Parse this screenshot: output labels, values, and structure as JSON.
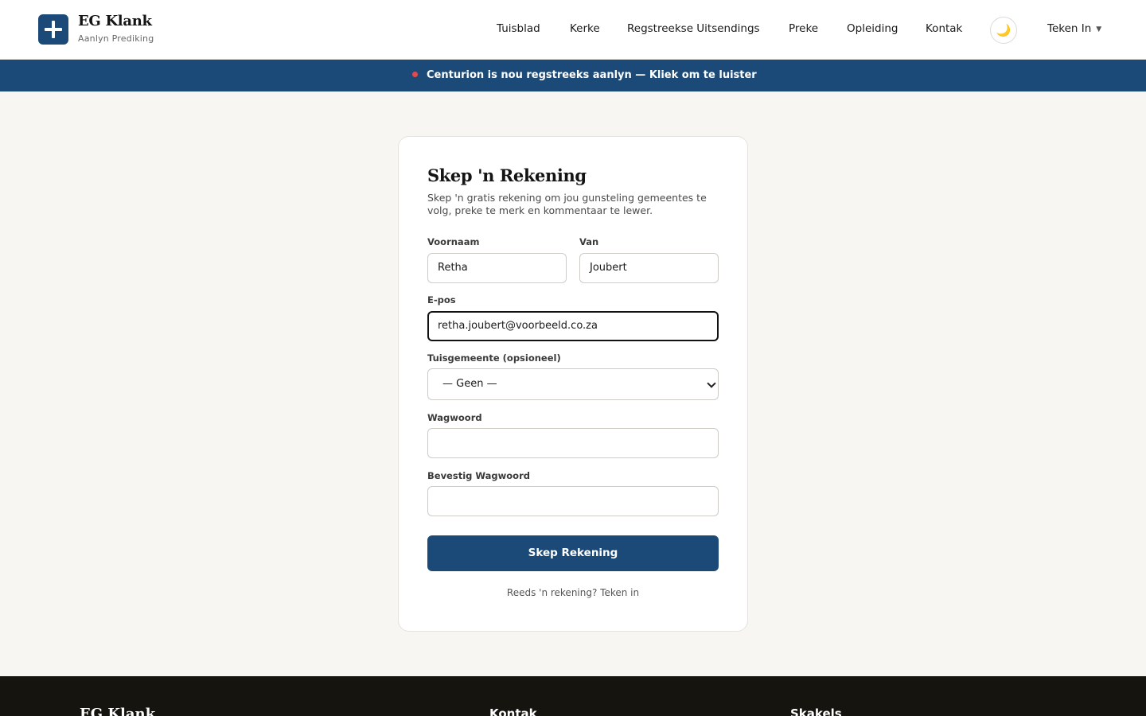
{
  "header": {
    "brand_title": "EG Klank",
    "brand_subtitle": "Aanlyn Prediking",
    "logo_icon": "plus-cross-icon",
    "nav": [
      "Tuisblad",
      "Kerke",
      "Regstreekse Uitsendings",
      "Preke",
      "Opleiding",
      "Kontak"
    ],
    "theme_toggle_icon": "moon-icon",
    "theme_toggle_glyph": "🌙",
    "signin_label": "Teken In"
  },
  "banner": {
    "text": "Centurion is nou regstreeks aanlyn — Kliek om te luister",
    "dot_color": "#e24b4b"
  },
  "form": {
    "title": "Skep 'n Rekening",
    "description": "Skep 'n gratis rekening om jou gunsteling gemeentes te volg, preke te merk en kommentaar te lewer.",
    "first_name_label": "Voornaam",
    "first_name_value": "Retha",
    "last_name_label": "Van",
    "last_name_value": "Joubert",
    "email_label": "E-pos",
    "email_value": "retha.joubert@voorbeeld.co.za",
    "congregation_label": "Tuisgemeente (opsioneel)",
    "congregation_value": "— Geen —",
    "password_label": "Wagwoord",
    "password_value": "",
    "confirm_password_label": "Bevestig Wagwoord",
    "confirm_password_value": "",
    "submit_label": "Skep Rekening",
    "signin_prompt": "Reeds 'n rekening? Teken in"
  },
  "footer": {
    "brand": "EG Klank",
    "col2_heading": "Kontak",
    "col3_heading": "Skakels"
  },
  "colors": {
    "primary": "#1c4a78",
    "background": "#f8f6f2",
    "footer": "#16140f"
  }
}
